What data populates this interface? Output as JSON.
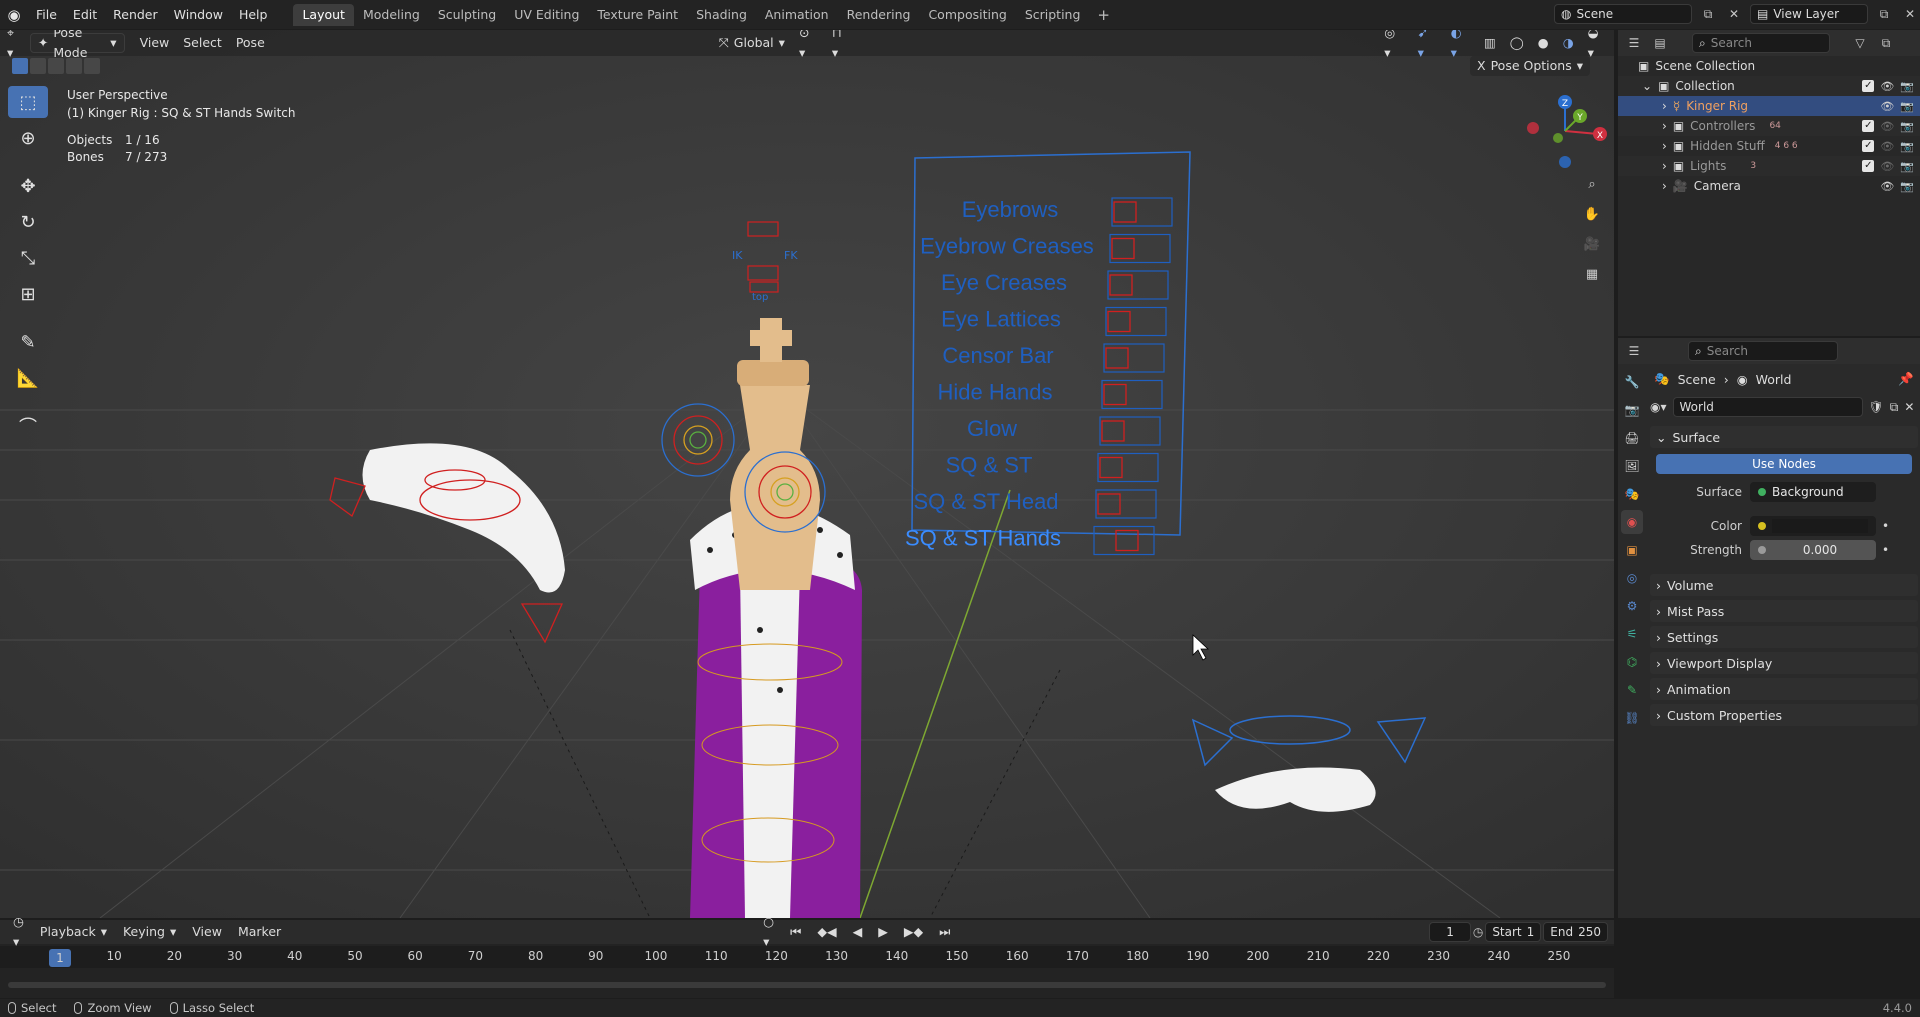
{
  "menu": [
    "File",
    "Edit",
    "Render",
    "Window",
    "Help"
  ],
  "workspaces": [
    "Layout",
    "Modeling",
    "Sculpting",
    "UV Editing",
    "Texture Paint",
    "Shading",
    "Animation",
    "Rendering",
    "Compositing",
    "Scripting"
  ],
  "workspace_add": "+",
  "scene_name": "Scene",
  "view_layer": "View Layer",
  "viewport": {
    "mode": "Pose Mode",
    "menus": [
      "View",
      "Select",
      "Pose"
    ],
    "orientation": "Global",
    "pose_options": "Pose Options",
    "x_toggle": "X",
    "perspective": "User Perspective",
    "active": "(1) Kinger Rig : SQ & ST Hands Switch",
    "stats": [
      {
        "label": "Objects",
        "value": "1 / 16"
      },
      {
        "label": "Bones",
        "value": "7 / 273"
      }
    ],
    "board_items": [
      "Eyebrows",
      "Eyebrow Creases",
      "Eye Creases",
      "Eye Lattices",
      "Censor Bar",
      "Hide Hands",
      "Glow",
      "SQ & ST",
      "SQ & ST Head",
      "SQ & ST Hands"
    ],
    "head_labels": {
      "ik": "IK",
      "fk": "FK",
      "top": "top"
    },
    "gizmo": {
      "x": "X",
      "y": "Y",
      "z": "Z"
    }
  },
  "outliner": {
    "search_placeholder": "Search",
    "items": [
      {
        "label": "Scene Collection",
        "level": 0
      },
      {
        "label": "Collection",
        "level": 1
      },
      {
        "label": "Kinger Rig",
        "level": 2,
        "selected": true
      },
      {
        "label": "Controllers",
        "level": 1,
        "count": "64"
      },
      {
        "label": "Hidden Stuff",
        "level": 1,
        "count": "4 6 6"
      },
      {
        "label": "Lights",
        "level": 1,
        "count": "3"
      },
      {
        "label": "Camera",
        "level": 1
      }
    ]
  },
  "properties": {
    "search_placeholder": "Search",
    "breadcrumb": [
      "Scene",
      "World"
    ],
    "world_name": "World",
    "surface_panel": "Surface",
    "use_nodes": "Use Nodes",
    "surface_label": "Surface",
    "surface_value": "Background",
    "color_label": "Color",
    "strength_label": "Strength",
    "strength_value": "0.000",
    "panels": [
      "Volume",
      "Mist Pass",
      "Settings",
      "Viewport Display",
      "Animation",
      "Custom Properties"
    ]
  },
  "timeline": {
    "menus": [
      "Playback",
      "Keying",
      "View",
      "Marker"
    ],
    "current_frame": "1",
    "start_label": "Start",
    "start": "1",
    "end_label": "End",
    "end": "250",
    "ruler": [
      "1",
      "10",
      "20",
      "30",
      "40",
      "50",
      "60",
      "70",
      "80",
      "90",
      "100",
      "110",
      "120",
      "130",
      "140",
      "150",
      "160",
      "170",
      "180",
      "190",
      "200",
      "210",
      "220",
      "230",
      "240",
      "250"
    ]
  },
  "statusbar": {
    "select": "Select",
    "zoom": "Zoom View",
    "lasso": "Lasso Select",
    "version": "4.4.0"
  },
  "colors": {
    "accent": "#4772b3",
    "rig_blue": "#1f6fd6",
    "rig_red": "#d02020",
    "robe": "#8a1f9e"
  }
}
